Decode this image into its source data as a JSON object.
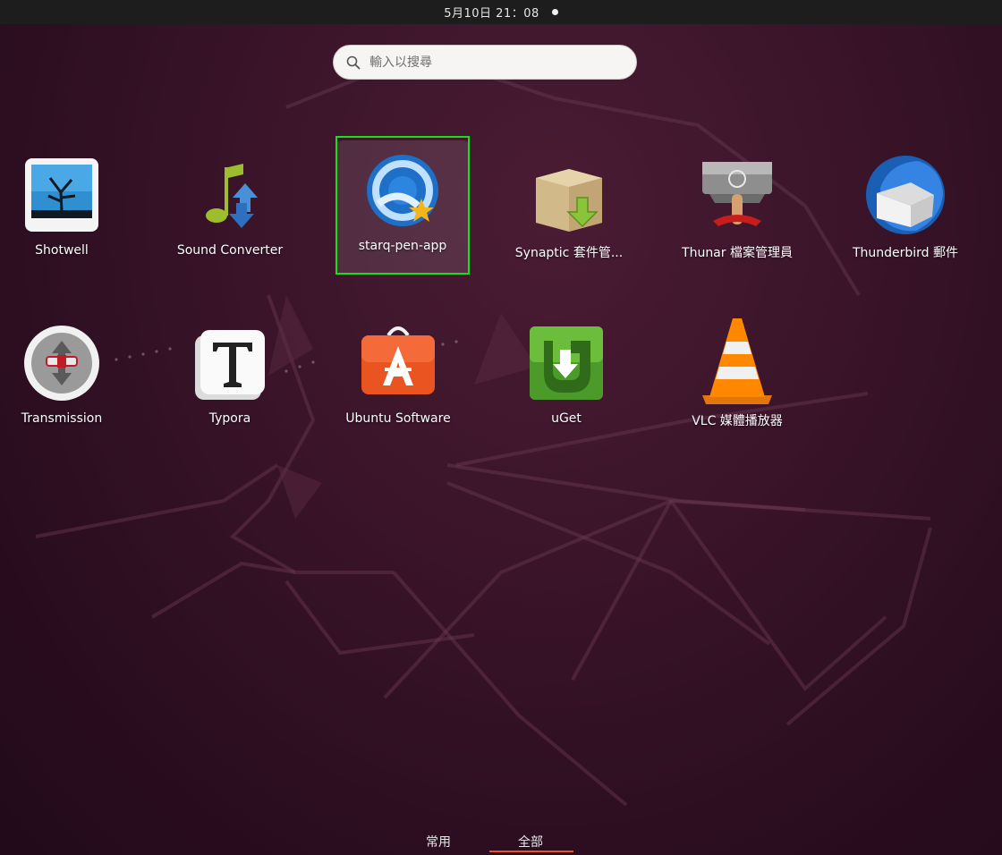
{
  "topbar": {
    "datetime": "5月10日  21：08"
  },
  "search": {
    "placeholder": "輸入以搜尋"
  },
  "apps": [
    {
      "label": "Shotwell",
      "icon": "shotwell-icon"
    },
    {
      "label": "Sound Converter",
      "icon": "sound-converter-icon"
    },
    {
      "label": "starq-pen-app",
      "icon": "starq-pen-app-icon"
    },
    {
      "label": "Synaptic 套件管...",
      "icon": "synaptic-package-icon"
    },
    {
      "label": "Thunar 檔案管理員",
      "icon": "thunar-file-manager-icon"
    },
    {
      "label": "Thunderbird 郵件",
      "icon": "thunderbird-mail-icon"
    },
    {
      "label": "Transmission",
      "icon": "transmission-icon"
    },
    {
      "label": "Typora",
      "icon": "typora-icon"
    },
    {
      "label": "Ubuntu Software",
      "icon": "ubuntu-software-icon"
    },
    {
      "label": "uGet",
      "icon": "uget-icon"
    },
    {
      "label": "VLC 媒體播放器",
      "icon": "vlc-cone-icon"
    }
  ],
  "tabs": {
    "frequent": "常用",
    "all": "全部",
    "active": "all"
  },
  "colors": {
    "accent": "#e95420",
    "selection_outline": "#16e016"
  }
}
